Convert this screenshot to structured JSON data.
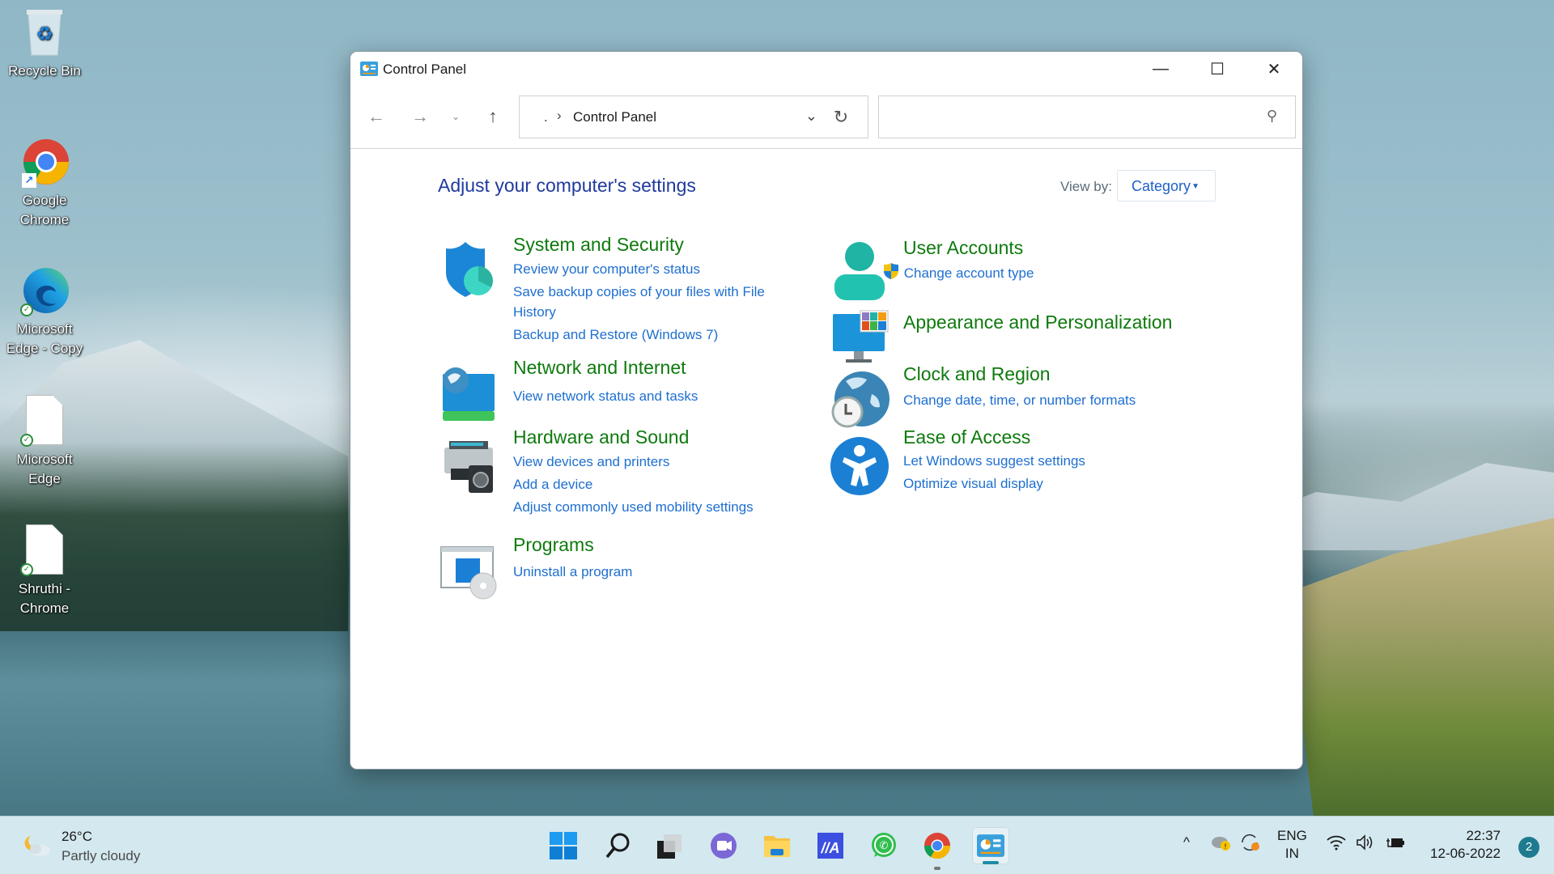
{
  "desktop": {
    "icons": [
      {
        "label": "Recycle Bin",
        "icon": "recycle-bin-icon"
      },
      {
        "label": "Google Chrome",
        "icon": "chrome-icon",
        "shortcut": true
      },
      {
        "label": "Microsoft Edge - Copy",
        "icon": "edge-icon",
        "synced": true
      },
      {
        "label": "Microsoft Edge",
        "icon": "blank-file-icon",
        "synced": true
      },
      {
        "label": "Shruthi - Chrome",
        "icon": "blank-file-icon",
        "synced": true
      }
    ]
  },
  "window": {
    "title": "Control Panel",
    "controls": {
      "minimize": "—",
      "maximize": "☐",
      "close": "✕"
    },
    "nav": {
      "back": "←",
      "forward": "→",
      "recent": "⌄",
      "up": "↑"
    },
    "address": {
      "prefix": ".",
      "separator": "›",
      "path": "Control Panel",
      "dropdown": "⌄",
      "refresh": "↻"
    },
    "search": {
      "placeholder": "",
      "value": ""
    },
    "heading": "Adjust your computer's settings",
    "view_by": {
      "label": "View by:",
      "selected": "Category"
    },
    "categories": [
      {
        "title": "System and Security",
        "icon": "shield-icon",
        "links": [
          "Review your computer's status",
          "Save backup copies of your files with File",
          "History",
          "Backup and Restore (Windows 7)"
        ]
      },
      {
        "title": "Network and Internet",
        "icon": "network-globe-icon",
        "links": [
          "View network status and tasks"
        ]
      },
      {
        "title": "Hardware and Sound",
        "icon": "printer-speaker-icon",
        "links": [
          "View devices and printers",
          "Add a device",
          "Adjust commonly used mobility settings"
        ]
      },
      {
        "title": "Programs",
        "icon": "programs-icon",
        "links": [
          "Uninstall a program"
        ]
      },
      {
        "title": "User Accounts",
        "icon": "user-icon",
        "links": [
          "Change account type"
        ]
      },
      {
        "title": "Appearance and Personalization",
        "icon": "monitor-palette-icon",
        "links": []
      },
      {
        "title": "Clock and Region",
        "icon": "globe-clock-icon",
        "links": [
          "Change date, time, or number formats"
        ]
      },
      {
        "title": "Ease of Access",
        "icon": "accessibility-icon",
        "links": [
          "Let Windows suggest settings",
          "Optimize visual display"
        ]
      }
    ],
    "colors": {
      "heading": "#1f3a9e",
      "category_title": "#0e7a0d",
      "link": "#1e6fd0"
    }
  },
  "taskbar": {
    "weather": {
      "temp": "26°C",
      "desc": "Partly cloudy"
    },
    "apps": [
      {
        "name": "start",
        "running": false
      },
      {
        "name": "search",
        "running": false
      },
      {
        "name": "task-view",
        "running": false
      },
      {
        "name": "teams-chat",
        "running": false
      },
      {
        "name": "file-explorer",
        "running": false
      },
      {
        "name": "app-ma",
        "running": false
      },
      {
        "name": "whatsapp",
        "running": false
      },
      {
        "name": "chrome",
        "running": true
      },
      {
        "name": "control-panel",
        "running": true,
        "active": true
      }
    ],
    "tray": {
      "chevron": "^",
      "lang_line1": "ENG",
      "lang_line2": "IN",
      "time": "22:37",
      "date": "12-06-2022",
      "notifications": "2"
    }
  }
}
